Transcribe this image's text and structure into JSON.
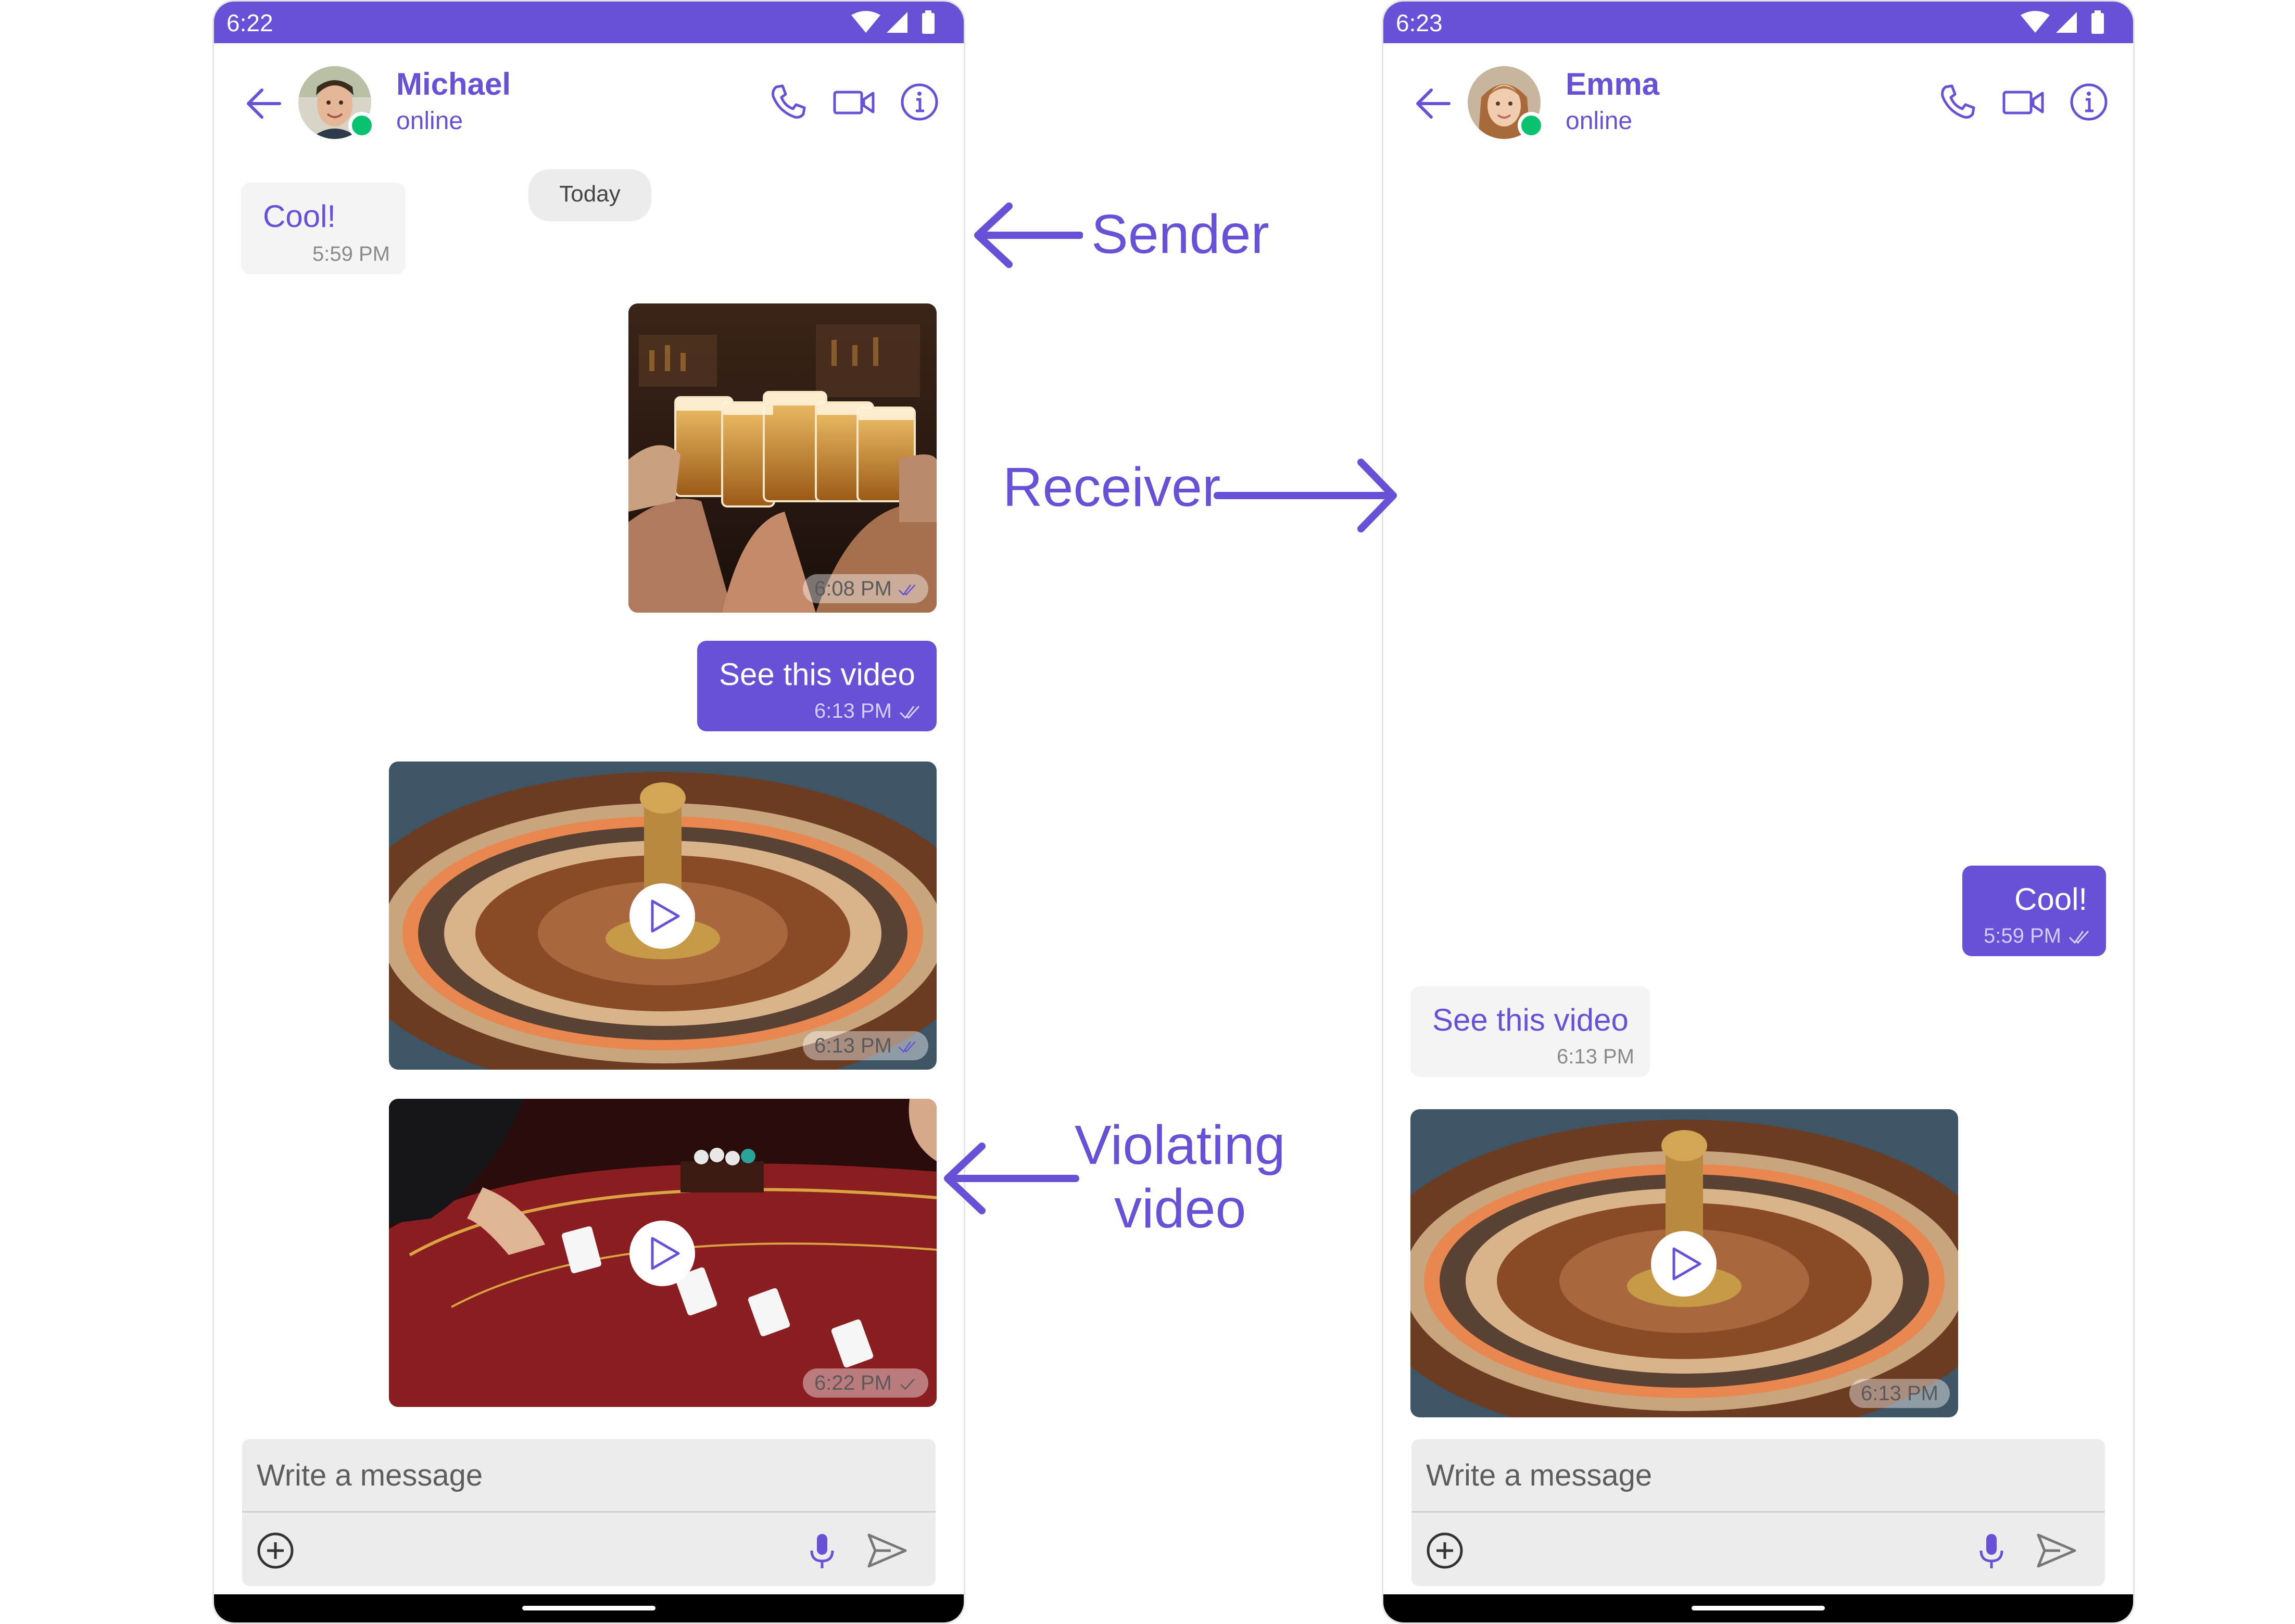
{
  "colors": {
    "accent": "#6851d6",
    "online": "#09c26f",
    "incoming_bubble": "#f4f4f4"
  },
  "left_phone": {
    "status_time": "6:22",
    "contact_name": "Michael",
    "contact_status": "online",
    "date_divider": "Today",
    "messages": [
      {
        "type": "text",
        "direction": "incoming",
        "text": "Cool!",
        "time": "5:59 PM"
      },
      {
        "type": "image",
        "direction": "outgoing",
        "content": "beer-toast",
        "time": "6:08 PM"
      },
      {
        "type": "text",
        "direction": "outgoing",
        "text": "See this video",
        "time": "6:13 PM"
      },
      {
        "type": "video",
        "direction": "outgoing",
        "content": "roulette",
        "time": "6:13 PM"
      },
      {
        "type": "video",
        "direction": "outgoing",
        "content": "blackjack-table",
        "time": "6:22 PM"
      }
    ],
    "composer_placeholder": "Write a message"
  },
  "right_phone": {
    "status_time": "6:23",
    "contact_name": "Emma",
    "contact_status": "online",
    "messages": [
      {
        "type": "text",
        "direction": "outgoing",
        "text": "Cool!",
        "time": "5:59 PM"
      },
      {
        "type": "text",
        "direction": "incoming",
        "text": "See this video",
        "time": "6:13 PM"
      },
      {
        "type": "video",
        "direction": "incoming",
        "content": "roulette",
        "time": "6:13 PM"
      }
    ],
    "composer_placeholder": "Write a message"
  },
  "annotations": {
    "sender": "Sender",
    "receiver": "Receiver",
    "violating_line1": "Violating",
    "violating_line2": "video"
  },
  "icons": [
    "back-arrow-icon",
    "phone-icon",
    "video-camera-icon",
    "info-icon",
    "play-icon",
    "plus-circle-icon",
    "microphone-icon",
    "send-icon",
    "double-check-icon",
    "wifi-icon",
    "signal-icon",
    "battery-icon"
  ]
}
